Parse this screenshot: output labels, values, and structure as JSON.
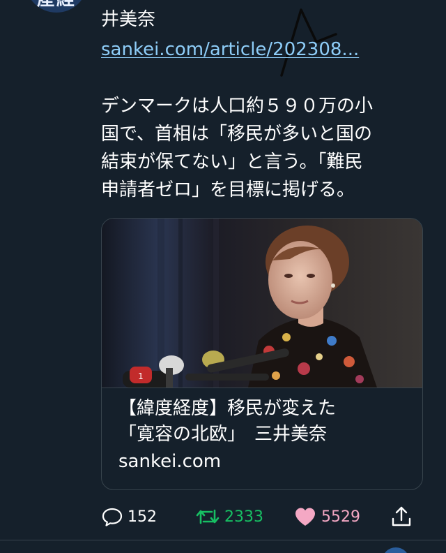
{
  "tweet": {
    "avatar_text": "産経",
    "author_tail": "井美奈",
    "link_text": "sankei.com/article/202308...",
    "text_lines": [
      "デンマークは人口約５９０万の小",
      "国で、首相は「移民が多いと国の",
      "結束が保てない」と言う。「難民",
      "申請者ゼロ」を目標に掲げる。"
    ]
  },
  "card": {
    "title_lines": [
      "【緯度経度】移民が変えた",
      "「寛容の北欧」　三井美奈"
    ],
    "domain": "sankei.com",
    "image_icon": "photo-podium-speaker"
  },
  "actions": {
    "reply_count": "152",
    "retweet_count": "2333",
    "like_count": "5529",
    "reply_icon": "speech-bubble-icon",
    "retweet_icon": "retweet-icon",
    "like_icon": "heart-icon",
    "share_icon": "share-icon"
  },
  "colors": {
    "background": "#15202b",
    "link": "#8ecdf8",
    "retweet_active": "#17bf63",
    "like_active": "#f4a8c4",
    "icon_default": "#ffffff",
    "border": "#38444d"
  }
}
